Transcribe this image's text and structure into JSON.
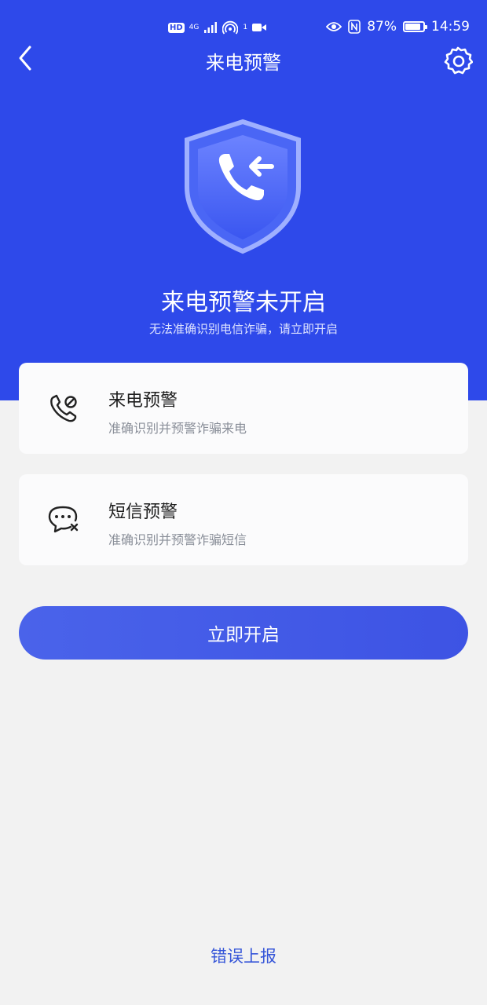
{
  "status_bar": {
    "hd": "HD",
    "network": "4G",
    "hotspot_count": "1",
    "battery": "87%",
    "battery_level": 0.87,
    "time": "14:59"
  },
  "header": {
    "title": "来电预警"
  },
  "hero": {
    "title": "来电预警未开启",
    "subtitle": "无法准确识别电信诈骗，请立即开启"
  },
  "features": [
    {
      "title": "来电预警",
      "subtitle": "准确识别并预警诈骗来电",
      "icon": "phone-block-icon"
    },
    {
      "title": "短信预警",
      "subtitle": "准确识别并预警诈骗短信",
      "icon": "message-block-icon"
    }
  ],
  "actions": {
    "enable_label": "立即开启",
    "report_label": "错误上报"
  },
  "colors": {
    "primary": "#2e49ea",
    "button": "#4a63ea",
    "link": "#3555d8",
    "background": "#f2f2f2"
  }
}
